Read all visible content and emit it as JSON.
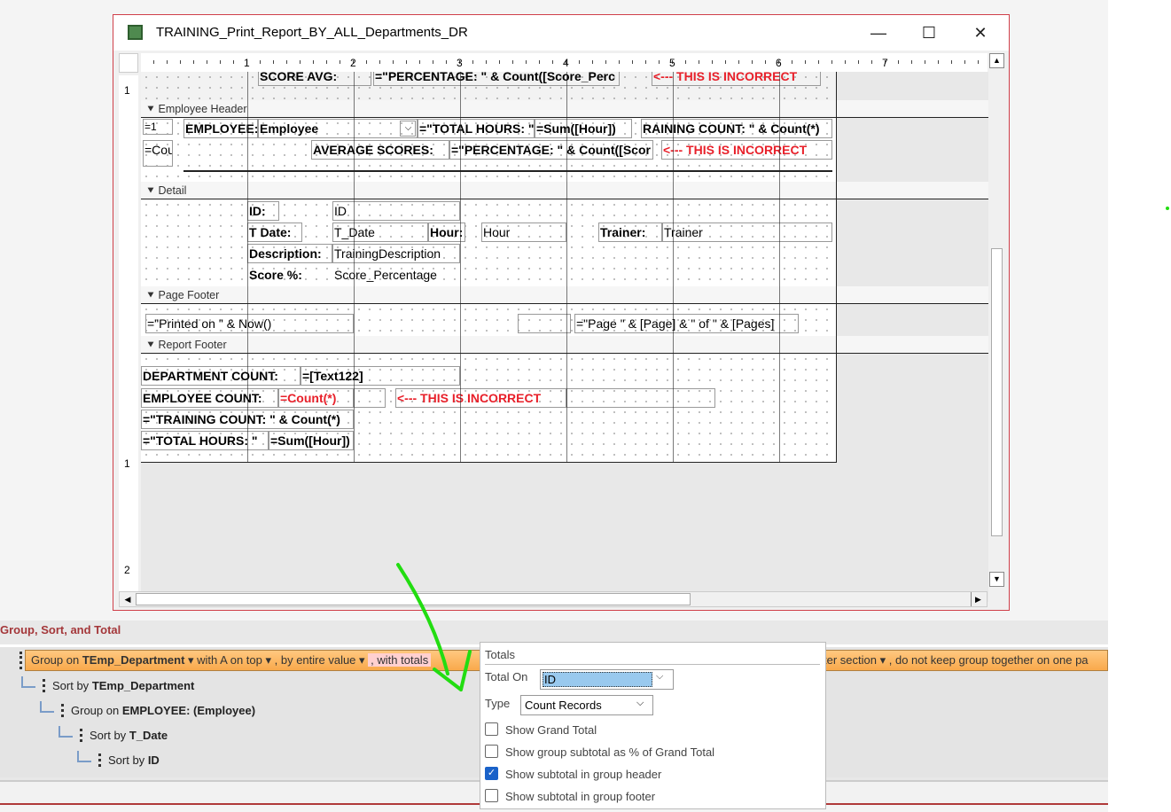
{
  "window": {
    "title": "TRAINING_Print_Report_BY_ALL_Departments_DR",
    "minimize": "—",
    "maximize": "☐",
    "close": "✕"
  },
  "ruler": {
    "h": [
      "1",
      "2",
      "3",
      "4",
      "5",
      "6",
      "7"
    ],
    "v": [
      "1",
      "1",
      "2"
    ]
  },
  "sections": {
    "employee_header": "Employee Header",
    "detail": "Detail",
    "page_footer": "Page Footer",
    "report_footer": "Report Footer"
  },
  "top_band": {
    "score_avg": "SCORE AVG:",
    "percentage": "=\"PERCENTAGE: \" & Count([Score_Perc",
    "incorrect": "<--- THIS IS INCORRECT"
  },
  "employee_header": {
    "eq1": "=1",
    "employee_label": "EMPLOYEE:",
    "employee_value": "Employee",
    "total_hours": "=\"TOTAL HOURS: \"",
    "sum_hour": "=Sum([Hour])",
    "training_count": "RAINING COUNT: \" & Count(*)",
    "cou": "=Cou",
    "average_scores": "AVERAGE SCORES:",
    "percentage": "=\"PERCENTAGE: \" & Count([Scor",
    "incorrect": "<--- THIS IS INCORRECT"
  },
  "detail": {
    "id_label": "ID:",
    "id_value": "ID",
    "tdate_label": "T Date:",
    "tdate_value": "T_Date",
    "hour_label": "Hour:",
    "hour_value": "Hour",
    "trainer_label": "Trainer:",
    "trainer_value": "Trainer",
    "desc_label": "Description:",
    "desc_value": "TrainingDescription",
    "score_label": "Score %:",
    "score_value": "Score_Percentage"
  },
  "page_footer": {
    "printed": "=\"Printed on \" & Now()",
    "page": "=\"Page \" & [Page] & \" of \" & [Pages]"
  },
  "report_footer": {
    "dept_label": "DEPARTMENT COUNT:",
    "dept_value": "=[Text122]",
    "emp_label": "EMPLOYEE COUNT:",
    "emp_value": "=Count(*)",
    "incorrect": "<--- THIS IS INCORRECT",
    "training_count": "=\"TRAINING COUNT: \" & Count(*)",
    "total_hours": "=\"TOTAL HOURS: \"",
    "sum_hour": "=Sum([Hour])"
  },
  "group_sort": {
    "title": "Group, Sort, and Total",
    "group_row": {
      "prefix": "Group on",
      "field": "TEmp_Department",
      "order": "with A on top",
      "by": ", by entire value",
      "totals": ", with totals",
      "section": "ter section",
      "keep": ", do not keep group together on one pa"
    },
    "rows": [
      {
        "prefix": "Sort by",
        "field": "TEmp_Department"
      },
      {
        "prefix": "Group on",
        "field": "EMPLOYEE: (Employee)"
      },
      {
        "prefix": "Sort by",
        "field": "T_Date"
      },
      {
        "prefix": "Sort by",
        "field": "ID"
      }
    ]
  },
  "totals_popup": {
    "title": "Totals",
    "total_on_label": "Total On",
    "total_on_value": "ID",
    "type_label": "Type",
    "type_value": "Count Records",
    "options": [
      {
        "label": "Show Grand Total",
        "checked": false
      },
      {
        "label": "Show group subtotal as % of Grand Total",
        "checked": false
      },
      {
        "label": "Show subtotal in group header",
        "checked": true
      },
      {
        "label": "Show subtotal in group footer",
        "checked": false
      }
    ]
  },
  "colors": {
    "accent": "#1a62c9",
    "incorrect": "#e8202a",
    "annotation": "#22dd11"
  }
}
